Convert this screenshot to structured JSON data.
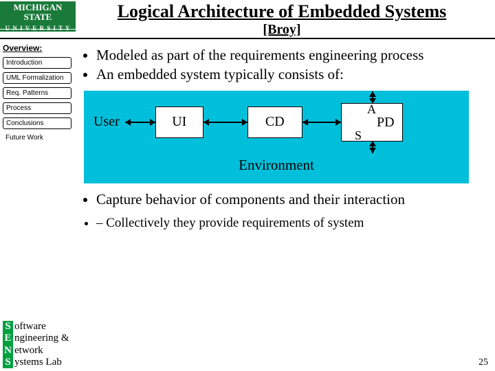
{
  "logo": {
    "line1": "MICHIGAN STATE",
    "line2": "U N I V E R S I T Y"
  },
  "title": "Logical Architecture of Embedded Systems",
  "subtitle": "[Broy]",
  "sidebar": {
    "heading": "Overview:",
    "items": [
      {
        "label": "Introduction",
        "boxed": true
      },
      {
        "label": "UML Formalization",
        "boxed": true
      },
      {
        "label": "Req. Patterns",
        "boxed": true
      },
      {
        "label": "Process",
        "boxed": true
      },
      {
        "label": "Conclusions",
        "boxed": true
      },
      {
        "label": "Future Work",
        "boxed": false
      }
    ]
  },
  "bullets": {
    "b1": "Modeled as part of the requirements engineering process",
    "b2": "An embedded system typically consists of:",
    "b3": "Capture behavior of components and their interaction",
    "sub1": "Collectively they provide requirements of system"
  },
  "diagram": {
    "user": "User",
    "ui": "UI",
    "cd": "CD",
    "pd_a": "A",
    "pd_main": "PD",
    "pd_s": "S",
    "env": "Environment"
  },
  "footer": {
    "l1a": "S",
    "l1b": "oftware",
    "l2a": "E",
    "l2b": "ngineering &",
    "l3a": "N",
    "l3b": "etwork",
    "l4a": "S",
    "l4b": "ystems Lab"
  },
  "page": "25"
}
